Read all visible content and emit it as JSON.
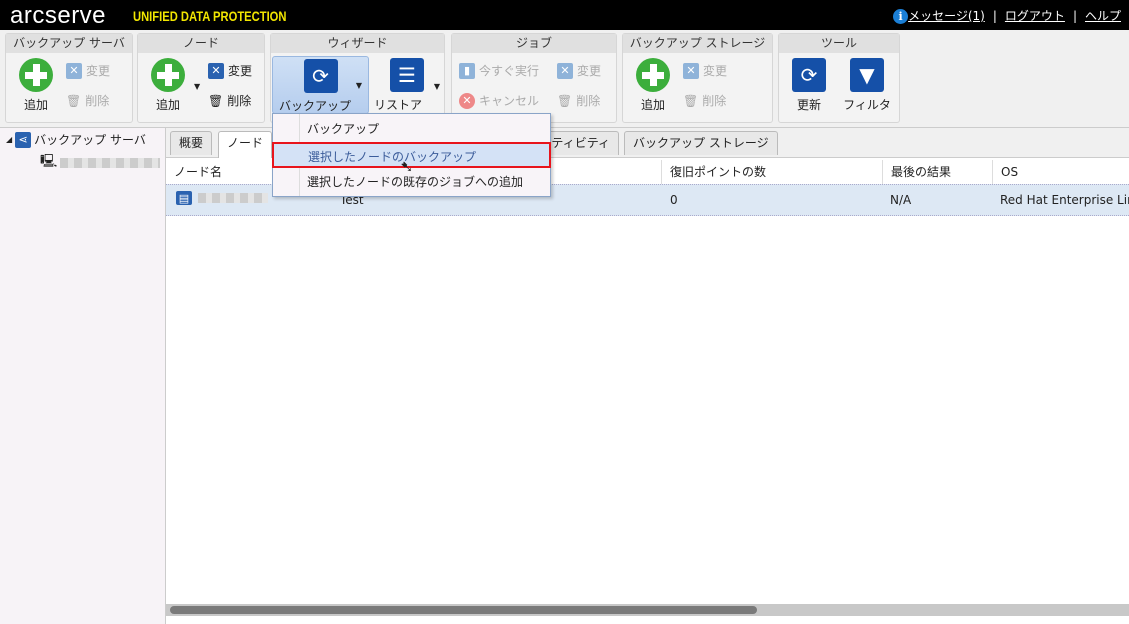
{
  "header": {
    "logo": "arcserve",
    "logo_sub": "UNIFIED DATA PROTECTION",
    "messages": "メッセージ(1)",
    "logout": "ログアウト",
    "help": "ヘルプ",
    "sep": "|"
  },
  "toolbar": {
    "backup_server": {
      "title": "バックアップ サーバ",
      "add": "追加",
      "modify": "変更",
      "delete": "削除"
    },
    "node": {
      "title": "ノード",
      "add": "追加",
      "modify": "変更",
      "delete": "削除"
    },
    "wizard": {
      "title": "ウィザード",
      "backup": "バックアップ",
      "restore": "リストア"
    },
    "job": {
      "title": "ジョブ",
      "run_now": "今すぐ実行",
      "modify": "変更",
      "cancel": "キャンセル",
      "delete": "削除"
    },
    "storage": {
      "title": "バックアップ ストレージ",
      "add": "追加",
      "modify": "変更",
      "delete": "削除"
    },
    "tools": {
      "title": "ツール",
      "refresh": "更新",
      "filter": "フィルタ"
    }
  },
  "tree": {
    "root": "バックアップ サーバ"
  },
  "tabs": [
    "概要",
    "ノード",
    "アクティビティ ログ",
    "バックアップ ストレージ"
  ],
  "menu": {
    "items": [
      "バックアップ",
      "選択したノードのバックアップ",
      "選択したノードの既存のジョブへの追加"
    ],
    "highlighted": 1
  },
  "table": {
    "columns": [
      "ノード名",
      "プ",
      "復旧ポイントの数",
      "最後の結果",
      "OS"
    ],
    "rows": [
      {
        "plan": "Test",
        "recovery_points": "0",
        "last_result": "N/A",
        "os": "Red Hat Enterprise Linux"
      }
    ]
  },
  "colors": {
    "accent": "#1b7fd6",
    "highlight": "#e8141c",
    "logo_yellow": "#f2e600"
  }
}
